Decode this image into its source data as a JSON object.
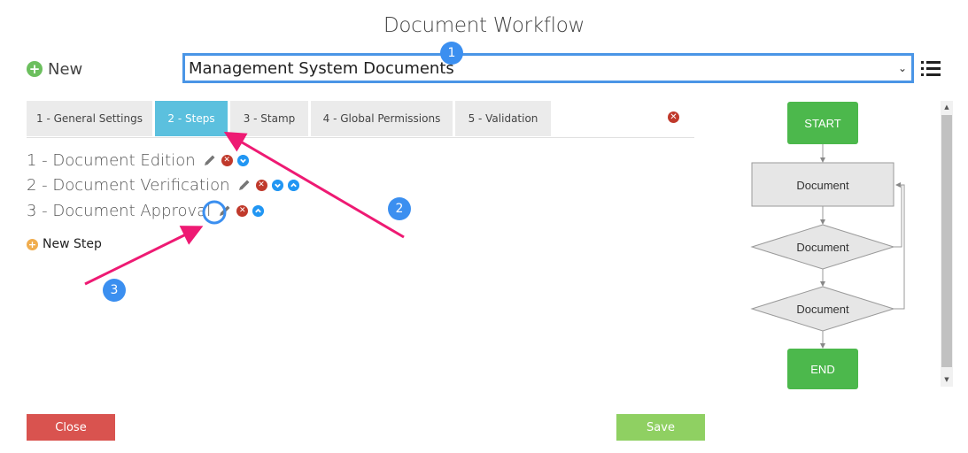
{
  "title": "Document Workflow",
  "new_label": "New",
  "workflow_select": {
    "value": "Management System Documents"
  },
  "tabs": [
    {
      "label": "1 - General Settings",
      "active": false
    },
    {
      "label": "2 - Steps",
      "active": true
    },
    {
      "label": "3 - Stamp",
      "active": false
    },
    {
      "label": "4 - Global Permissions",
      "active": false
    },
    {
      "label": "5 - Validation",
      "active": false
    }
  ],
  "steps": [
    {
      "label": "1 - Document Edition"
    },
    {
      "label": "2 - Document Verification"
    },
    {
      "label": "3 - Document Approval"
    }
  ],
  "new_step_label": "New Step",
  "flowchart": {
    "start": "START",
    "node1": "Document",
    "node2": "Document",
    "node3": "Document",
    "end": "END"
  },
  "annotations": [
    "1",
    "2",
    "3"
  ],
  "buttons": {
    "close": "Close",
    "save": "Save"
  },
  "colors": {
    "accent_blue": "#4a95e6",
    "active_tab": "#5bc0de",
    "start_end_green": "#4cb84c",
    "arrow_pink": "#ee1a73",
    "close_red": "#d9534f",
    "save_green": "#8fd062"
  }
}
